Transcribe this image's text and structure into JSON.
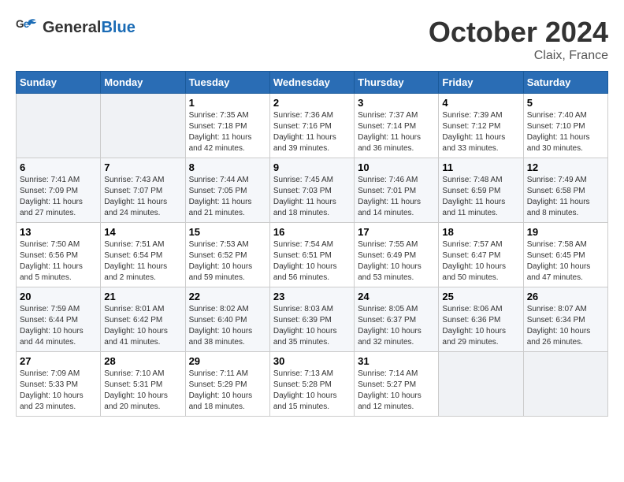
{
  "logo": {
    "line1": "General",
    "line2": "Blue"
  },
  "header": {
    "month": "October 2024",
    "location": "Claix, France"
  },
  "weekdays": [
    "Sunday",
    "Monday",
    "Tuesday",
    "Wednesday",
    "Thursday",
    "Friday",
    "Saturday"
  ],
  "weeks": [
    [
      {
        "day": "",
        "info": ""
      },
      {
        "day": "",
        "info": ""
      },
      {
        "day": "1",
        "info": "Sunrise: 7:35 AM\nSunset: 7:18 PM\nDaylight: 11 hours and 42 minutes."
      },
      {
        "day": "2",
        "info": "Sunrise: 7:36 AM\nSunset: 7:16 PM\nDaylight: 11 hours and 39 minutes."
      },
      {
        "day": "3",
        "info": "Sunrise: 7:37 AM\nSunset: 7:14 PM\nDaylight: 11 hours and 36 minutes."
      },
      {
        "day": "4",
        "info": "Sunrise: 7:39 AM\nSunset: 7:12 PM\nDaylight: 11 hours and 33 minutes."
      },
      {
        "day": "5",
        "info": "Sunrise: 7:40 AM\nSunset: 7:10 PM\nDaylight: 11 hours and 30 minutes."
      }
    ],
    [
      {
        "day": "6",
        "info": "Sunrise: 7:41 AM\nSunset: 7:09 PM\nDaylight: 11 hours and 27 minutes."
      },
      {
        "day": "7",
        "info": "Sunrise: 7:43 AM\nSunset: 7:07 PM\nDaylight: 11 hours and 24 minutes."
      },
      {
        "day": "8",
        "info": "Sunrise: 7:44 AM\nSunset: 7:05 PM\nDaylight: 11 hours and 21 minutes."
      },
      {
        "day": "9",
        "info": "Sunrise: 7:45 AM\nSunset: 7:03 PM\nDaylight: 11 hours and 18 minutes."
      },
      {
        "day": "10",
        "info": "Sunrise: 7:46 AM\nSunset: 7:01 PM\nDaylight: 11 hours and 14 minutes."
      },
      {
        "day": "11",
        "info": "Sunrise: 7:48 AM\nSunset: 6:59 PM\nDaylight: 11 hours and 11 minutes."
      },
      {
        "day": "12",
        "info": "Sunrise: 7:49 AM\nSunset: 6:58 PM\nDaylight: 11 hours and 8 minutes."
      }
    ],
    [
      {
        "day": "13",
        "info": "Sunrise: 7:50 AM\nSunset: 6:56 PM\nDaylight: 11 hours and 5 minutes."
      },
      {
        "day": "14",
        "info": "Sunrise: 7:51 AM\nSunset: 6:54 PM\nDaylight: 11 hours and 2 minutes."
      },
      {
        "day": "15",
        "info": "Sunrise: 7:53 AM\nSunset: 6:52 PM\nDaylight: 10 hours and 59 minutes."
      },
      {
        "day": "16",
        "info": "Sunrise: 7:54 AM\nSunset: 6:51 PM\nDaylight: 10 hours and 56 minutes."
      },
      {
        "day": "17",
        "info": "Sunrise: 7:55 AM\nSunset: 6:49 PM\nDaylight: 10 hours and 53 minutes."
      },
      {
        "day": "18",
        "info": "Sunrise: 7:57 AM\nSunset: 6:47 PM\nDaylight: 10 hours and 50 minutes."
      },
      {
        "day": "19",
        "info": "Sunrise: 7:58 AM\nSunset: 6:45 PM\nDaylight: 10 hours and 47 minutes."
      }
    ],
    [
      {
        "day": "20",
        "info": "Sunrise: 7:59 AM\nSunset: 6:44 PM\nDaylight: 10 hours and 44 minutes."
      },
      {
        "day": "21",
        "info": "Sunrise: 8:01 AM\nSunset: 6:42 PM\nDaylight: 10 hours and 41 minutes."
      },
      {
        "day": "22",
        "info": "Sunrise: 8:02 AM\nSunset: 6:40 PM\nDaylight: 10 hours and 38 minutes."
      },
      {
        "day": "23",
        "info": "Sunrise: 8:03 AM\nSunset: 6:39 PM\nDaylight: 10 hours and 35 minutes."
      },
      {
        "day": "24",
        "info": "Sunrise: 8:05 AM\nSunset: 6:37 PM\nDaylight: 10 hours and 32 minutes."
      },
      {
        "day": "25",
        "info": "Sunrise: 8:06 AM\nSunset: 6:36 PM\nDaylight: 10 hours and 29 minutes."
      },
      {
        "day": "26",
        "info": "Sunrise: 8:07 AM\nSunset: 6:34 PM\nDaylight: 10 hours and 26 minutes."
      }
    ],
    [
      {
        "day": "27",
        "info": "Sunrise: 7:09 AM\nSunset: 5:33 PM\nDaylight: 10 hours and 23 minutes."
      },
      {
        "day": "28",
        "info": "Sunrise: 7:10 AM\nSunset: 5:31 PM\nDaylight: 10 hours and 20 minutes."
      },
      {
        "day": "29",
        "info": "Sunrise: 7:11 AM\nSunset: 5:29 PM\nDaylight: 10 hours and 18 minutes."
      },
      {
        "day": "30",
        "info": "Sunrise: 7:13 AM\nSunset: 5:28 PM\nDaylight: 10 hours and 15 minutes."
      },
      {
        "day": "31",
        "info": "Sunrise: 7:14 AM\nSunset: 5:27 PM\nDaylight: 10 hours and 12 minutes."
      },
      {
        "day": "",
        "info": ""
      },
      {
        "day": "",
        "info": ""
      }
    ]
  ]
}
